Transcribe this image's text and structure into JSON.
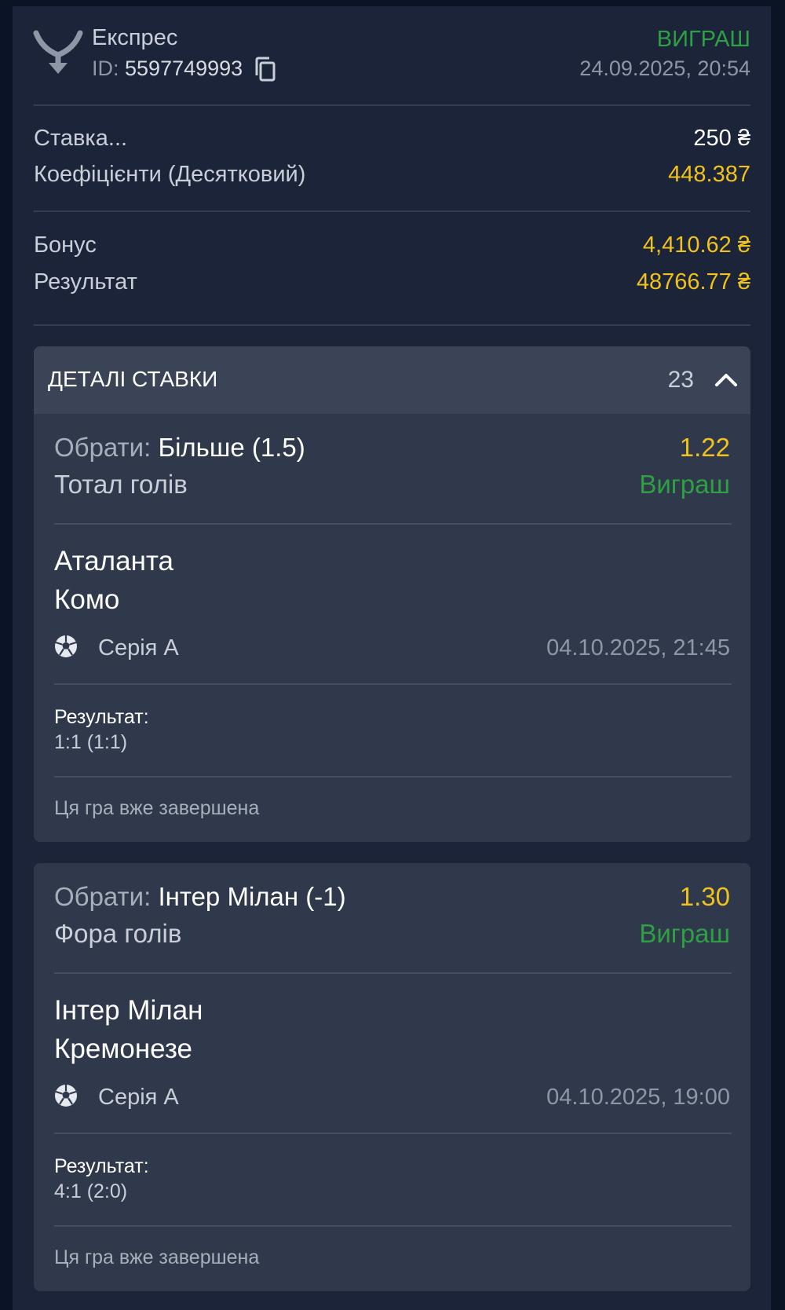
{
  "header": {
    "bet_type": "Експрес",
    "id_label": "ID: ",
    "id_value": "5597749993",
    "status": "ВИГРАШ",
    "datetime": "24.09.2025, 20:54",
    "icons": {
      "logo": "brand-y-logo-icon",
      "copy": "copy-icon"
    }
  },
  "summary": {
    "stake_label": "Ставка...",
    "stake_value": "250 ₴",
    "odds_label": "Коефіцієнти (Десятковий)",
    "odds_value": "448.387",
    "bonus_label": "Бонус",
    "bonus_value": "4,410.62 ₴",
    "result_label": "Результат",
    "result_value": "48766.77 ₴"
  },
  "details": {
    "title": "ДЕТАЛІ СТАВКИ",
    "count": "23",
    "toggle_icon": "chevron-up-icon"
  },
  "selections": [
    {
      "pick_label": "Обрати: ",
      "pick_value": "Більше (1.5)",
      "odds": "1.22",
      "market": "Тотал голів",
      "status": "Виграш",
      "team_home": "Аталанта",
      "team_away": "Комо",
      "sport_icon": "soccer-ball-icon",
      "league": "Серія А",
      "match_datetime": "04.10.2025, 21:45",
      "result_label": "Результат:",
      "result_value": "1:1 (1:1)",
      "finished_note": "Ця гра вже завершена"
    },
    {
      "pick_label": "Обрати: ",
      "pick_value": "Інтер Мілан (-1)",
      "odds": "1.30",
      "market": "Фора голів",
      "status": "Виграш",
      "team_home": "Інтер Мілан",
      "team_away": "Кремонезе",
      "sport_icon": "soccer-ball-icon",
      "league": "Серія А",
      "match_datetime": "04.10.2025, 19:00",
      "result_label": "Результат:",
      "result_value": "4:1 (2:0)",
      "finished_note": "Ця гра вже завершена"
    }
  ],
  "colors": {
    "background": "#0b1424",
    "panel": "#1b2438",
    "card": "#2f394b",
    "win_green": "#2ea043",
    "odds_yellow": "#f1c21b"
  }
}
